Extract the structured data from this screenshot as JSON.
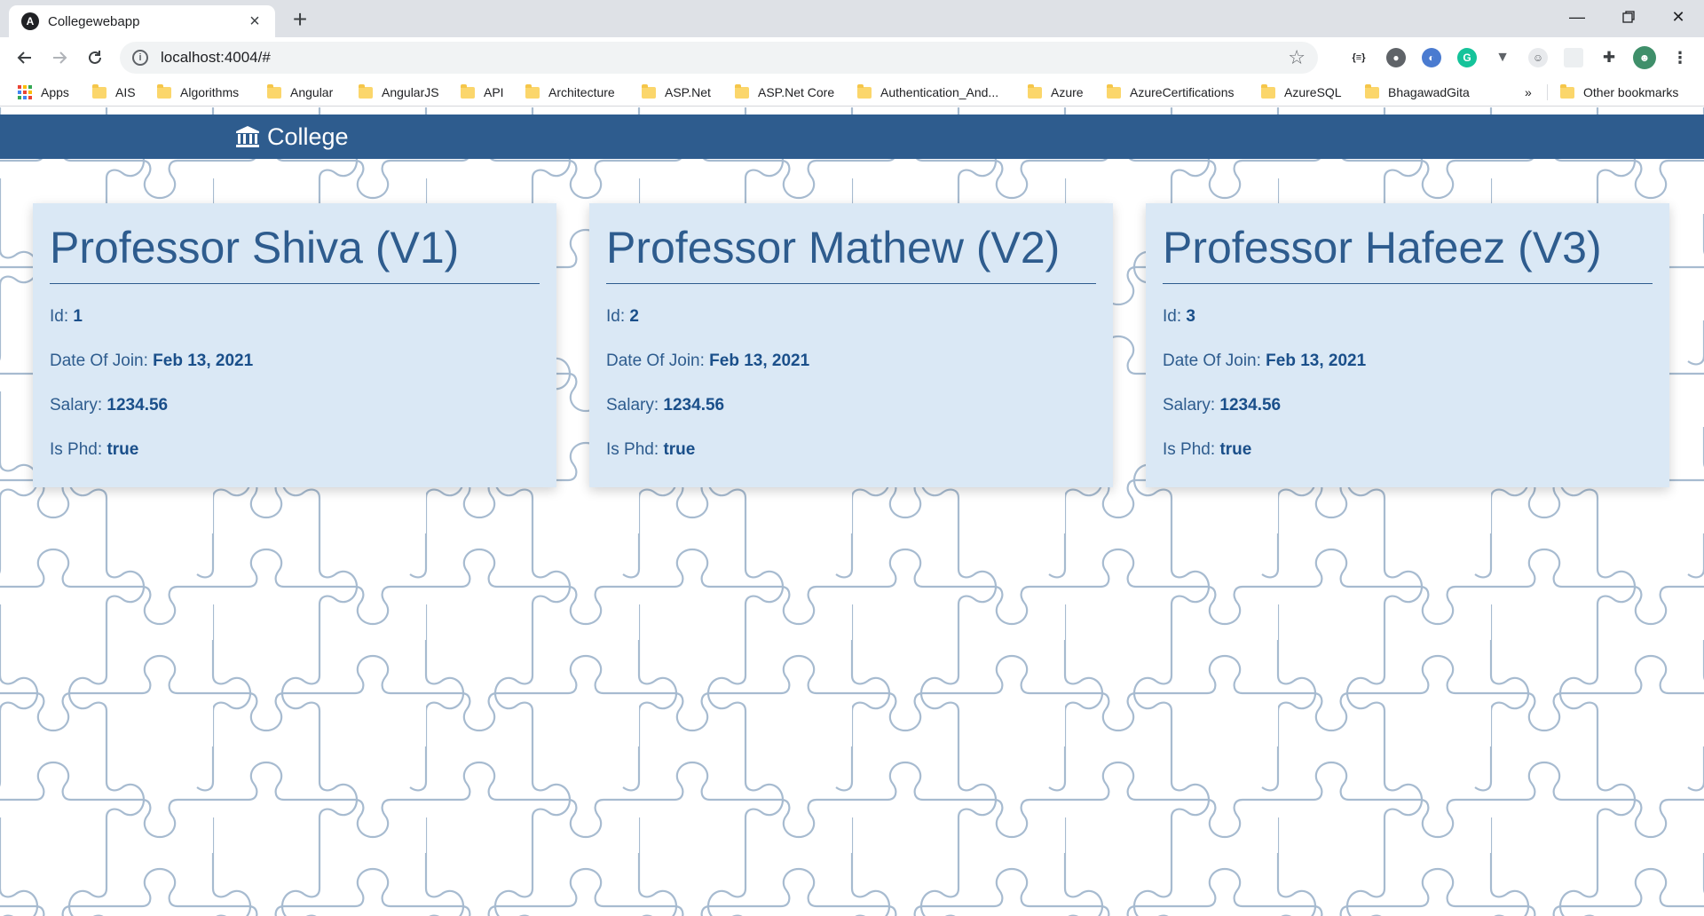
{
  "browser": {
    "tab_title": "Collegewebapp",
    "tab_favicon": "A",
    "url": "localhost:4004/#",
    "bookmarks": [
      "Apps",
      "AIS",
      "Algorithms",
      "Angular",
      "AngularJS",
      "API",
      "Architecture",
      "ASP.Net",
      "ASP.Net Core",
      "Authentication_And...",
      "Azure",
      "AzureCertifications",
      "AzureSQL",
      "BhagawadGita"
    ],
    "overflow": "»",
    "other_bookmarks": "Other bookmarks"
  },
  "app": {
    "brand": "College",
    "navbar_color": "#2e5c8e",
    "card_bg": "#dae8f5"
  },
  "labels": {
    "id": "Id:",
    "doj": "Date Of Join:",
    "salary": "Salary:",
    "phd": "Is Phd:"
  },
  "professors": [
    {
      "title": "Professor Shiva (V1)",
      "id": "1",
      "date_of_join": "Feb 13, 2021",
      "salary": "1234.56",
      "is_phd": "true"
    },
    {
      "title": "Professor Mathew (V2)",
      "id": "2",
      "date_of_join": "Feb 13, 2021",
      "salary": "1234.56",
      "is_phd": "true"
    },
    {
      "title": "Professor Hafeez (V3)",
      "id": "3",
      "date_of_join": "Feb 13, 2021",
      "salary": "1234.56",
      "is_phd": "true"
    }
  ]
}
